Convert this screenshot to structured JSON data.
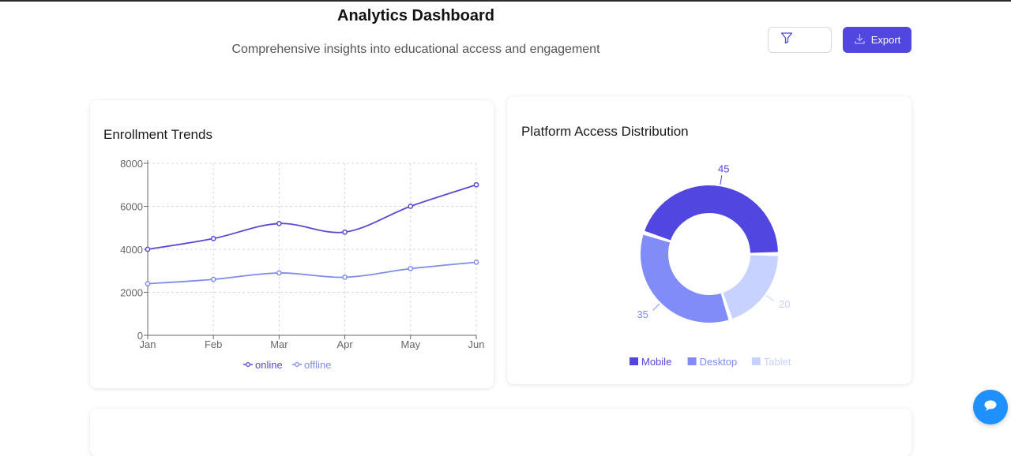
{
  "header": {
    "title": "Analytics Dashboard",
    "subtitle": "Comprehensive insights into educational access and engagement",
    "filter_icon": "filter-icon",
    "export_icon": "download-icon",
    "export_label": "Export"
  },
  "colors": {
    "accent": "#5146e0",
    "online": "#5a48d6",
    "offline": "#7f8de8",
    "mobile": "#5146e0",
    "desktop": "#818cf8",
    "tablet": "#c7d2fe",
    "chat": "#1e90ff"
  },
  "trend_card": {
    "title": "Enrollment Trends"
  },
  "platform_card": {
    "title": "Platform Access Distribution"
  },
  "chat": {
    "icon": "chat-bubble-icon"
  },
  "chart_data": [
    {
      "type": "line",
      "title": "Enrollment Trends",
      "x": [
        "Jan",
        "Feb",
        "Mar",
        "Apr",
        "May",
        "Jun"
      ],
      "yticks": [
        "0",
        "2000",
        "4000",
        "6000",
        "8000"
      ],
      "ylim": [
        0,
        8000
      ],
      "grid": true,
      "legend_position": "bottom",
      "series": [
        {
          "name": "online",
          "values": [
            4000,
            4500,
            5200,
            4800,
            6000,
            7000
          ]
        },
        {
          "name": "offline",
          "values": [
            2400,
            2600,
            2900,
            2700,
            3100,
            3400
          ]
        }
      ]
    },
    {
      "type": "pie",
      "title": "Platform Access Distribution",
      "legend_position": "bottom",
      "slices": [
        {
          "name": "Mobile",
          "value": 45,
          "label": "45"
        },
        {
          "name": "Desktop",
          "value": 35,
          "label": "35"
        },
        {
          "name": "Tablet",
          "value": 20,
          "label": "20"
        }
      ]
    }
  ]
}
